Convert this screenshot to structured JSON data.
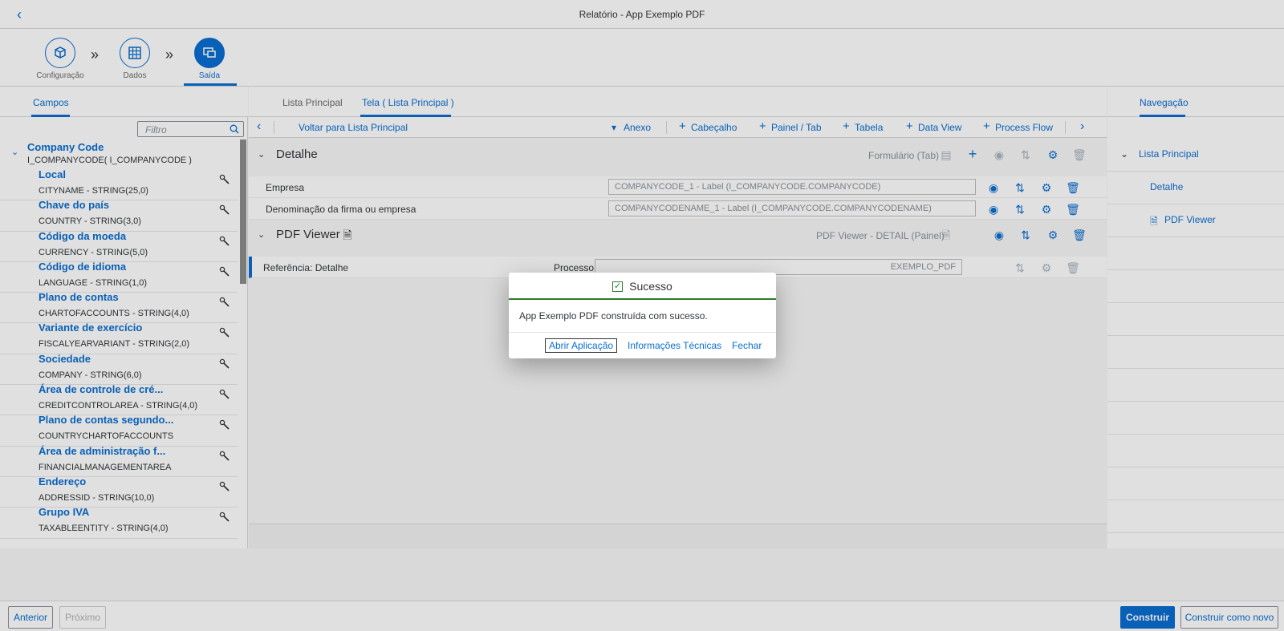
{
  "shell": {
    "title": "Relatório - App Exemplo PDF"
  },
  "wizard": {
    "steps": [
      {
        "label": "Configuração",
        "icon": "cube-icon"
      },
      {
        "label": "Dados",
        "icon": "table-grid-icon"
      },
      {
        "label": "Saída",
        "icon": "display-icon"
      }
    ]
  },
  "left_tabs": {
    "fields": "Campos"
  },
  "center_tabs": {
    "main_list": "Lista Principal",
    "screen": "Tela ( Lista Principal )"
  },
  "right_tabs": {
    "navigation": "Navegação"
  },
  "left": {
    "filter_placeholder": "Filtro",
    "root_title": "Company Code",
    "root_sub": "I_COMPANYCODE( I_COMPANYCODE )",
    "fields": [
      {
        "name": "Local",
        "type": "CITYNAME - STRING(25,0)"
      },
      {
        "name": "Chave do país",
        "type": "COUNTRY - STRING(3,0)"
      },
      {
        "name": "Código da moeda",
        "type": "CURRENCY - STRING(5,0)"
      },
      {
        "name": "Código de idioma",
        "type": "LANGUAGE - STRING(1,0)"
      },
      {
        "name": "Plano de contas",
        "type": "CHARTOFACCOUNTS - STRING(4,0)"
      },
      {
        "name": "Variante de exercício",
        "type": "FISCALYEARVARIANT - STRING(2,0)"
      },
      {
        "name": "Sociedade",
        "type": "COMPANY - STRING(6,0)"
      },
      {
        "name": "Área de controle de cré...",
        "type": "CREDITCONTROLAREA - STRING(4,0)"
      },
      {
        "name": "Plano de contas segundo...",
        "type": "COUNTRYCHARTOFACCOUNTS"
      },
      {
        "name": "Área de administração f...",
        "type": "FINANCIALMANAGEMENTAREA"
      },
      {
        "name": "Endereço",
        "type": "ADDRESSID - STRING(10,0)"
      },
      {
        "name": "Grupo IVA",
        "type": "TAXABLEENTITY - STRING(4,0)"
      }
    ]
  },
  "toolbar": {
    "back": "Voltar para Lista Principal",
    "attachment": "Anexo",
    "header": "Cabeçalho",
    "panel": "Painel / Tab",
    "table": "Tabela",
    "data_view": "Data View",
    "process_flow": "Process Flow"
  },
  "sections": {
    "detail_title": "Detalhe",
    "detail_type": "Formulário (Tab)",
    "rows": [
      {
        "label": "Empresa",
        "value": "COMPANYCODE_1 - Label (I_COMPANYCODE.COMPANYCODE)"
      },
      {
        "label": "Denominação da firma ou empresa",
        "value": "COMPANYCODENAME_1 - Label (I_COMPANYCODE.COMPANYCODENAME)"
      }
    ],
    "pdf_title": "PDF Viewer",
    "pdf_type": "PDF Viewer - DETAIL (Painel)",
    "ref_label": "Referência: Detalhe",
    "ref_process": "Processo",
    "ref_value": "EXEMPLO_PDF"
  },
  "right": {
    "items": [
      "Lista Principal",
      "Detalhe",
      "PDF Viewer"
    ]
  },
  "footer": {
    "previous": "Anterior",
    "next": "Próximo",
    "build": "Construir",
    "build_new": "Construir como novo"
  },
  "dialog": {
    "title": "Sucesso",
    "message": "App Exemplo PDF construída com sucesso.",
    "open_app": "Abrir Aplicação",
    "tech_info": "Informações Técnicas",
    "close": "Fechar"
  },
  "colors": {
    "accent": "#0a6ed1",
    "success": "#2b7d2b"
  }
}
